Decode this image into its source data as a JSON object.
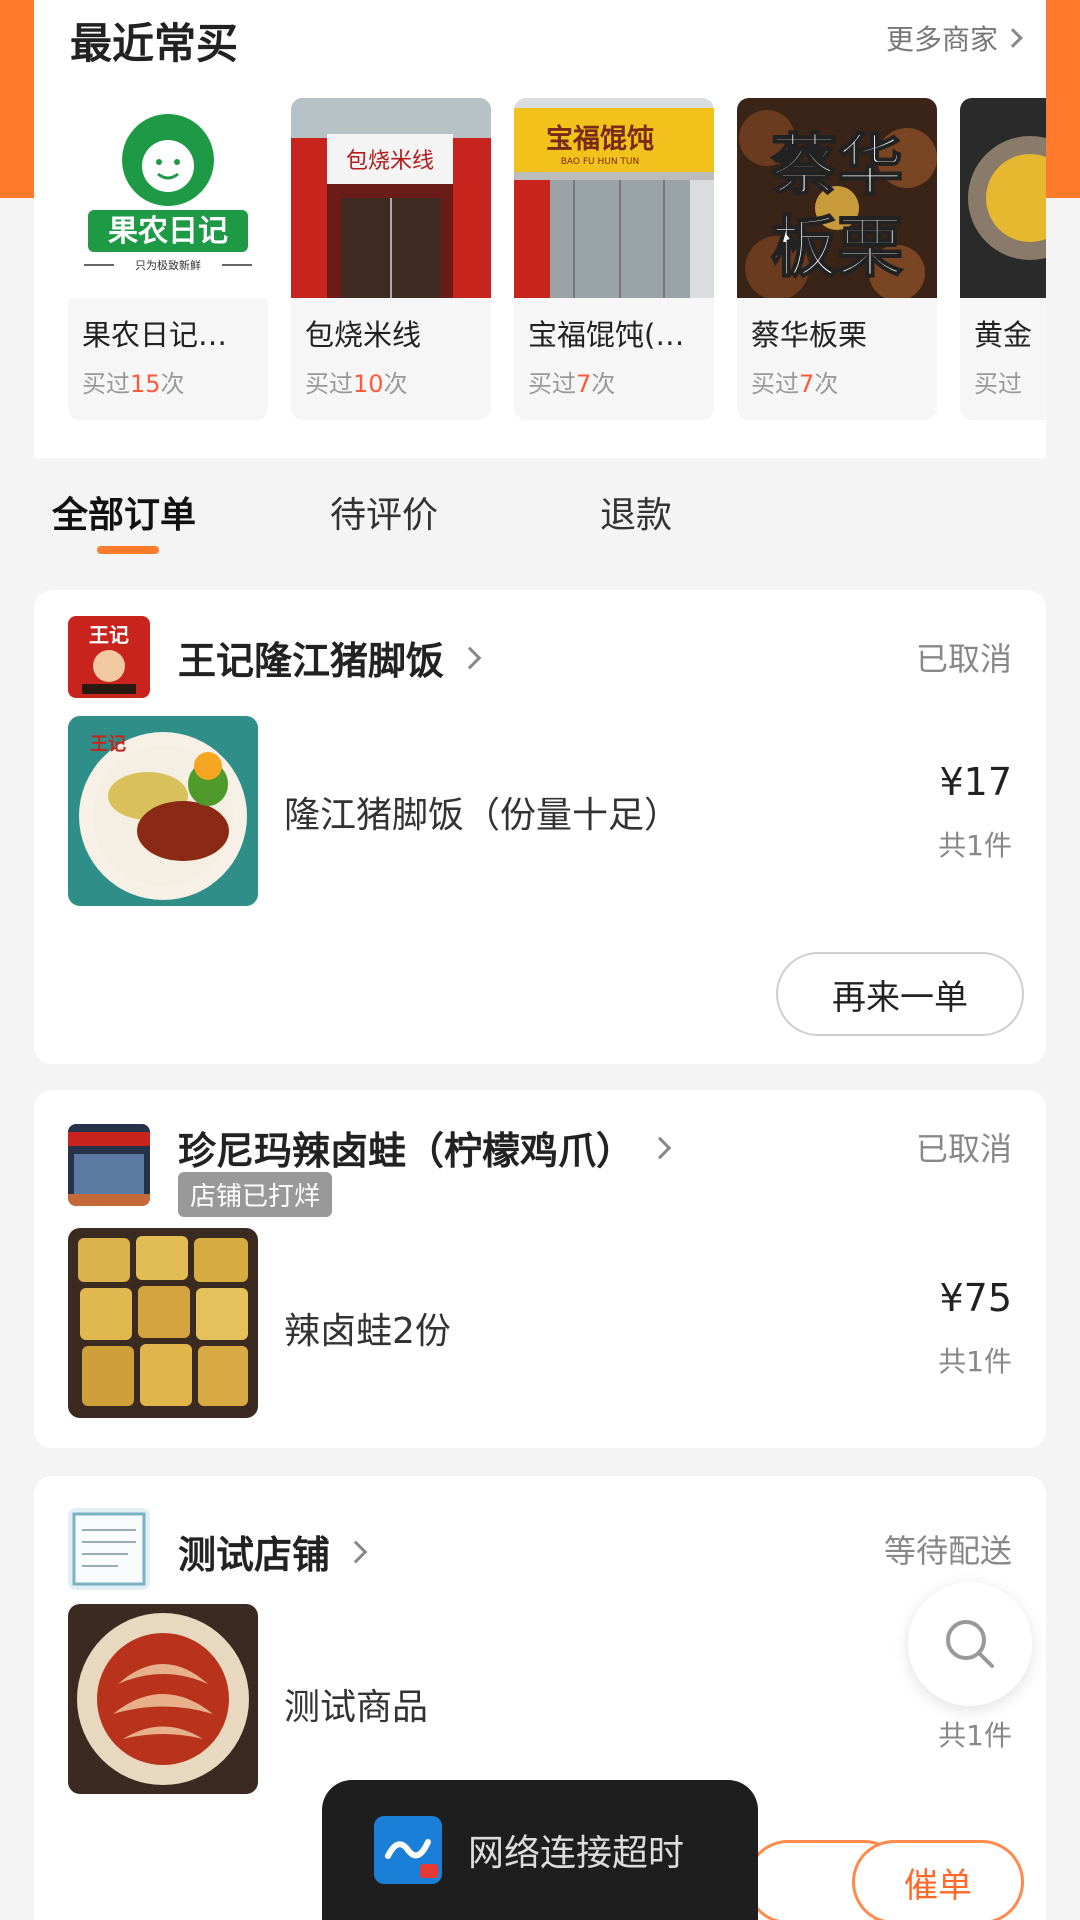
{
  "recent": {
    "title": "最近常买",
    "more_label": "更多商家",
    "stores": [
      {
        "name": "果农日记…",
        "count_prefix": "买过",
        "count": "15",
        "count_suffix": "次",
        "logo_text": "果农日记",
        "logo_sub": "只为极致新鲜"
      },
      {
        "name": "包烧米线",
        "count_prefix": "买过",
        "count": "10",
        "count_suffix": "次",
        "sign_text": "包烧米线"
      },
      {
        "name": "宝福馄饨(…",
        "count_prefix": "买过",
        "count": "7",
        "count_suffix": "次",
        "sign_text": "宝福馄饨",
        "sign_sub": "BAO FU HUN TUN"
      },
      {
        "name": "蔡华板栗",
        "count_prefix": "买过",
        "count": "7",
        "count_suffix": "次",
        "big_text_1": "蔡华",
        "big_text_2": "板栗"
      },
      {
        "name": "黄金",
        "count_prefix": "买过",
        "count": "",
        "count_suffix": ""
      }
    ]
  },
  "tabs": [
    {
      "label": "全部订单",
      "active": true
    },
    {
      "label": "待评价",
      "active": false
    },
    {
      "label": "退款",
      "active": false
    }
  ],
  "orders": [
    {
      "shop": "王记隆江猪脚饭",
      "logo_text": "王记",
      "status": "已取消",
      "goods": "隆江猪脚饭（份量十足）",
      "price": "¥17",
      "qty": "共1件",
      "button": "再来一单"
    },
    {
      "shop": "珍尼玛辣卤蛙（柠檬鸡爪）",
      "badge": "店铺已打烊",
      "status": "已取消",
      "goods": "辣卤蛙2份",
      "price": "¥75",
      "qty": "共1件"
    },
    {
      "shop": "测试店铺",
      "status": "等待配送",
      "goods": "测试商品",
      "qty": "共1件",
      "button": "催单"
    }
  ],
  "toast": {
    "text": "网络连接超时"
  },
  "colors": {
    "accent": "#ff7a2b",
    "price_highlight": "#ff5a3a"
  }
}
